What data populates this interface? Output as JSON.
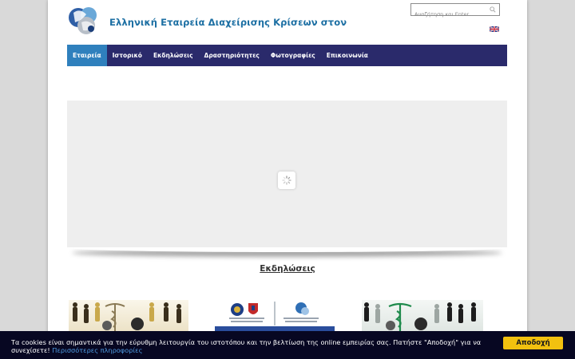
{
  "header": {
    "site_title": "Ελληνική Εταιρεία Διαχείρισης Κρίσεων στον"
  },
  "search": {
    "placeholder": "Αναζήτηση και Enter..."
  },
  "nav": {
    "items": [
      {
        "label": "Εταιρεία",
        "active": true
      },
      {
        "label": "Ιστορικό",
        "active": false
      },
      {
        "label": "Εκδηλώσεις",
        "active": false
      },
      {
        "label": "Δραστηριότητες",
        "active": false
      },
      {
        "label": "Φωτογραφίες",
        "active": false
      },
      {
        "label": "Επικοινωνία",
        "active": false
      }
    ]
  },
  "events": {
    "title": "Εκδηλώσεις"
  },
  "cookie": {
    "text": "Τα cookies είναι σημαντικά για την εύρυθμη λειτουργία του ιστοτόπου και την βελτίωση της online εμπειρίας σας. Πατήστε \"Αποδοχή\" για να συνεχίσετε!",
    "link": "Περισσότερες πληροφορίες",
    "accept": "Αποδοχή"
  },
  "colors": {
    "nav_bg": "#2a2a6b",
    "nav_active": "#2f80bd",
    "title": "#1c6fa3",
    "cookie_bg": "#070722",
    "cookie_button": "#f2c10f",
    "cookie_link": "#4f9ae0"
  }
}
